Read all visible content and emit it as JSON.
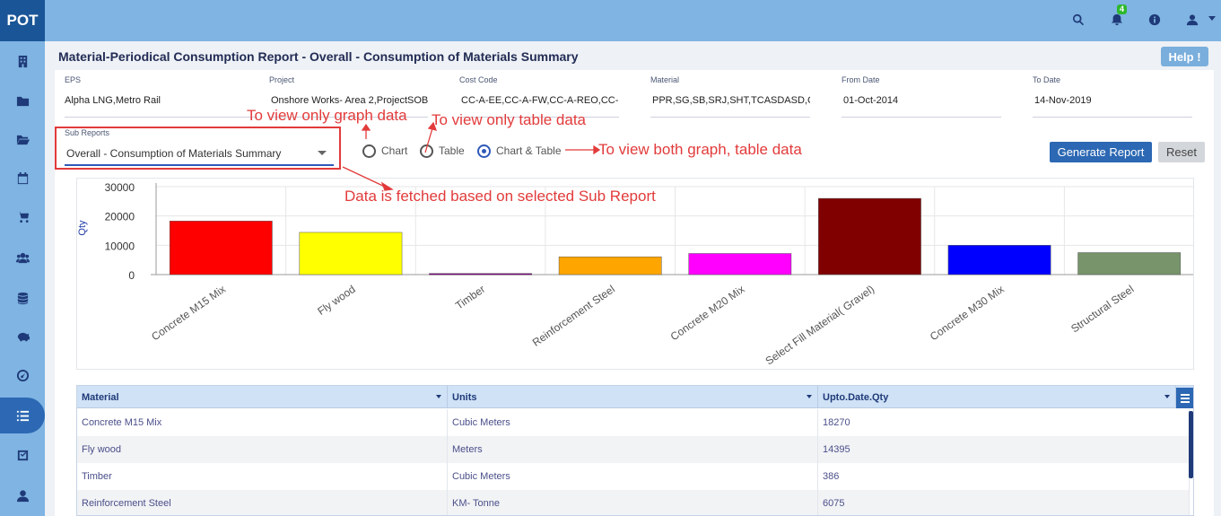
{
  "app": {
    "logo": "POT"
  },
  "topbar": {
    "notification_count": "4"
  },
  "page": {
    "title": "Material-Periodical Consumption Report - Overall - Consumption of Materials Summary",
    "help_label": "Help !"
  },
  "filters": [
    {
      "label": "EPS",
      "value": "Alpha LNG,Metro Rail"
    },
    {
      "label": "Project",
      "value": "Onshore  Works- Area 2,ProjectSOB"
    },
    {
      "label": "Cost Code",
      "value": "CC-A-EE,CC-A-FW,CC-A-REO,CC-"
    },
    {
      "label": "Material",
      "value": "PPR,SG,SB,SRJ,SHT,TCASDASD,C"
    },
    {
      "label": "From Date",
      "value": "01-Oct-2014"
    },
    {
      "label": "To Date",
      "value": "14-Nov-2019"
    }
  ],
  "sub_reports": {
    "label": "Sub Reports",
    "value": "Overall - Consumption of Materials Summary"
  },
  "view_options": [
    {
      "label": "Chart",
      "selected": false
    },
    {
      "label": "Table",
      "selected": false
    },
    {
      "label": "Chart & Table",
      "selected": true
    }
  ],
  "actions": {
    "generate": "Generate Report",
    "reset": "Reset"
  },
  "annotations": {
    "graph": "To view only graph data",
    "table": "To view only table data",
    "both": "To view both graph, table data",
    "subreport": "Data is fetched based on selected Sub Report"
  },
  "chart_data": {
    "type": "bar",
    "ylabel": "Qty",
    "ylim": [
      0,
      30000
    ],
    "yticks": [
      "30000",
      "20000",
      "10000",
      "0"
    ],
    "categories": [
      "Concrete M15 Mix",
      "Fly wood",
      "Timber",
      "Reinforcement Steel",
      "Concrete M20 Mix",
      "Select Fill Material( Gravel)",
      "Concrete M30 Mix",
      "Structural Steel"
    ],
    "values": [
      18270,
      14395,
      386,
      6075,
      7200,
      26000,
      10000,
      7500
    ],
    "colors": [
      "#ff0000",
      "#ffff00",
      "#800080",
      "#ffa500",
      "#ff00ff",
      "#800000",
      "#0000ff",
      "#77946b"
    ],
    "grid": true,
    "legend": "none"
  },
  "table": {
    "columns": [
      "Material",
      "Units",
      "Upto.Date.Qty"
    ],
    "rows": [
      [
        "Concrete M15 Mix",
        "Cubic Meters",
        "18270"
      ],
      [
        "Fly wood",
        "Meters",
        "14395"
      ],
      [
        "Timber",
        "Cubic Meters",
        "386"
      ],
      [
        "Reinforcement Steel",
        "KM- Tonne",
        "6075"
      ]
    ]
  }
}
